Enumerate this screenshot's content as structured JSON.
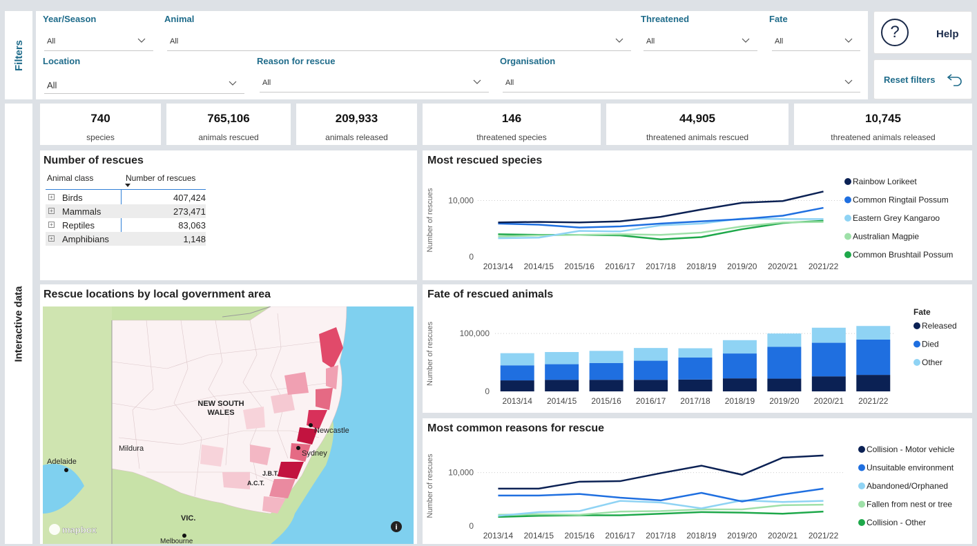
{
  "filters_label": "Filters",
  "interactive_label": "Interactive data",
  "filters": {
    "year_season": {
      "label": "Year/Season",
      "value": "All"
    },
    "animal": {
      "label": "Animal",
      "value": "All"
    },
    "threatened": {
      "label": "Threatened",
      "value": "All"
    },
    "fate": {
      "label": "Fate",
      "value": "All"
    },
    "location": {
      "label": "Location",
      "value": "All"
    },
    "reason": {
      "label": "Reason for rescue",
      "value": "All"
    },
    "organisation": {
      "label": "Organisation",
      "value": "All"
    }
  },
  "help_label": "Help",
  "help_glyph": "?",
  "reset_label": "Reset filters",
  "kpis": [
    {
      "value": "740",
      "label": "species"
    },
    {
      "value": "765,106",
      "label": "animals rescued"
    },
    {
      "value": "209,933",
      "label": "animals released"
    },
    {
      "value": "146",
      "label": "threatened species"
    },
    {
      "value": "44,905",
      "label": "threatened animals rescued"
    },
    {
      "value": "10,745",
      "label": "threatened animals released"
    }
  ],
  "matrix": {
    "title": "Number of rescues",
    "col1": "Animal class",
    "col2": "Number of rescues",
    "rows": [
      {
        "name": "Birds",
        "value": "407,424"
      },
      {
        "name": "Mammals",
        "value": "273,471"
      },
      {
        "name": "Reptiles",
        "value": "83,063"
      },
      {
        "name": "Amphibians",
        "value": "1,148"
      }
    ]
  },
  "map": {
    "title": "Rescue locations by local government area",
    "labels": {
      "nsw1": "NEW SOUTH",
      "nsw2": "WALES",
      "newcastle": "Newcastle",
      "sydney": "Sydney",
      "mildura": "Mildura",
      "adelaide": "Adelaide",
      "act": "A.C.T.",
      "jbt": "J.B.T.",
      "vic": "VIC.",
      "melbourne": "Melbourne"
    },
    "logo": "mapbox",
    "info_glyph": "i"
  },
  "colors": {
    "accent": "#1e6b8a",
    "navy": "#0b2154",
    "blue": "#1f6fe0",
    "lightblue": "#8fd3f4",
    "lightgreen": "#9ee0a8",
    "green": "#1ea84a",
    "sea": "#7fd0ef",
    "map_red": "#c2133f"
  },
  "chart_data": [
    {
      "type": "line",
      "title": "Most rescued species",
      "ylabel": "Number of rescues",
      "ylim": [
        0,
        13000
      ],
      "yticks": [
        "10,000",
        "0"
      ],
      "x": [
        "2013/14",
        "2014/15",
        "2015/16",
        "2016/17",
        "2017/18",
        "2018/19",
        "2019/20",
        "2020/21",
        "2021/22"
      ],
      "series": [
        {
          "name": "Rainbow Lorikeet",
          "color": "#0b2154",
          "values": [
            6100,
            6200,
            6100,
            6300,
            7100,
            8400,
            9600,
            9900,
            11600
          ]
        },
        {
          "name": "Common Ringtail Possum",
          "color": "#1f6fe0",
          "values": [
            5900,
            5700,
            5200,
            5400,
            5900,
            6300,
            6700,
            7300,
            8700
          ]
        },
        {
          "name": "Eastern Grey Kangaroo",
          "color": "#8fd3f4",
          "values": [
            3300,
            3400,
            4600,
            4500,
            5600,
            5900,
            6800,
            6700,
            6700
          ]
        },
        {
          "name": "Australian Magpie",
          "color": "#9ee0a8",
          "values": [
            3600,
            3800,
            3900,
            4000,
            3900,
            4300,
            5400,
            6100,
            6200
          ]
        },
        {
          "name": "Common Brushtail Possum",
          "color": "#1ea84a",
          "values": [
            4000,
            3900,
            3900,
            3800,
            3100,
            3500,
            4900,
            6000,
            6400
          ]
        }
      ]
    },
    {
      "type": "bar",
      "title": "Fate of rescued animals",
      "ylabel": "Number of rescues",
      "ylim": [
        0,
        130000
      ],
      "yticks": [
        "100,000",
        "0"
      ],
      "legend_title": "Fate",
      "categories": [
        "2013/14",
        "2014/15",
        "2015/16",
        "2016/17",
        "2017/18",
        "2018/19",
        "2019/20",
        "2020/21",
        "2021/22"
      ],
      "series": [
        {
          "name": "Released",
          "color": "#0b2154",
          "values": [
            19000,
            20000,
            20000,
            20000,
            20500,
            22500,
            22000,
            26000,
            28500
          ]
        },
        {
          "name": "Died",
          "color": "#1f6fe0",
          "values": [
            26000,
            27000,
            29000,
            33000,
            38000,
            43000,
            55000,
            58000,
            61000
          ]
        },
        {
          "name": "Other",
          "color": "#8fd3f4",
          "values": [
            21000,
            21000,
            21000,
            22000,
            16000,
            23000,
            23000,
            26000,
            23500
          ]
        }
      ]
    },
    {
      "type": "line",
      "title": "Most common reasons for rescue",
      "ylabel": "Number of rescues",
      "ylim": [
        0,
        15000
      ],
      "yticks": [
        "10,000",
        "0"
      ],
      "x": [
        "2013/14",
        "2014/15",
        "2015/16",
        "2016/17",
        "2017/18",
        "2018/19",
        "2019/20",
        "2020/21",
        "2021/22"
      ],
      "series": [
        {
          "name": "Collision - Motor vehicle",
          "color": "#0b2154",
          "values": [
            7000,
            7000,
            8300,
            8400,
            9900,
            11300,
            9600,
            12800,
            13200
          ]
        },
        {
          "name": "Unsuitable environment",
          "color": "#1f6fe0",
          "values": [
            5700,
            5700,
            6000,
            5300,
            4800,
            6200,
            4600,
            5900,
            7000
          ]
        },
        {
          "name": "Abandoned/Orphaned",
          "color": "#8fd3f4",
          "values": [
            1900,
            2600,
            2800,
            4700,
            4400,
            3300,
            4800,
            4500,
            4700
          ]
        },
        {
          "name": "Fallen from nest or tree",
          "color": "#9ee0a8",
          "values": [
            2100,
            2200,
            2100,
            2700,
            2800,
            3100,
            3100,
            3900,
            4000
          ]
        },
        {
          "name": "Collision - Other",
          "color": "#1ea84a",
          "values": [
            1700,
            1900,
            2000,
            2000,
            2300,
            2600,
            2500,
            2300,
            2700
          ]
        }
      ]
    }
  ]
}
